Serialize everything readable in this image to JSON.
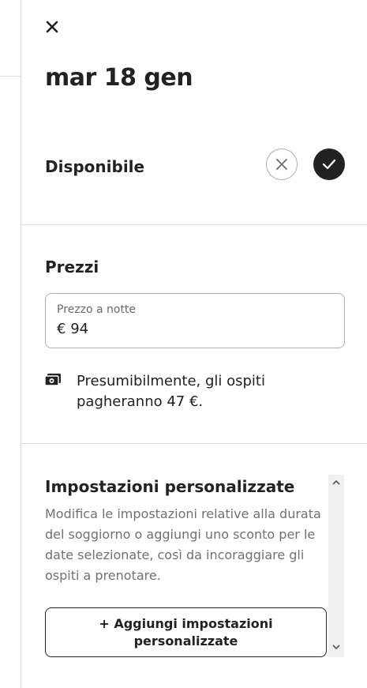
{
  "header": {
    "close_icon": "close-icon",
    "date_title": "mar 18 gen"
  },
  "availability": {
    "label": "Disponibile",
    "unavailable_icon": "x-icon",
    "available_icon": "checkmark-icon",
    "selected": "available"
  },
  "pricing": {
    "title": "Prezzi",
    "field_label": "Prezzo a notte",
    "currency": "€",
    "value": "94",
    "estimate_icon": "money-icon",
    "estimate_text": "Presumibilmente, gli ospiti pagheranno 47 €."
  },
  "custom_settings": {
    "title": "Impostazioni personalizzate",
    "description": "Modifica le impostazioni relative alla durata del soggiorno o aggiungi uno sconto per le date selezionate, così da incoraggiare gli ospiti a prenotare.",
    "add_button_label": "+ Aggiungi impostazioni personalizzate"
  },
  "colors": {
    "text": "#222222",
    "muted": "#717171",
    "border": "#dddddd",
    "selected_fill": "#222222"
  }
}
